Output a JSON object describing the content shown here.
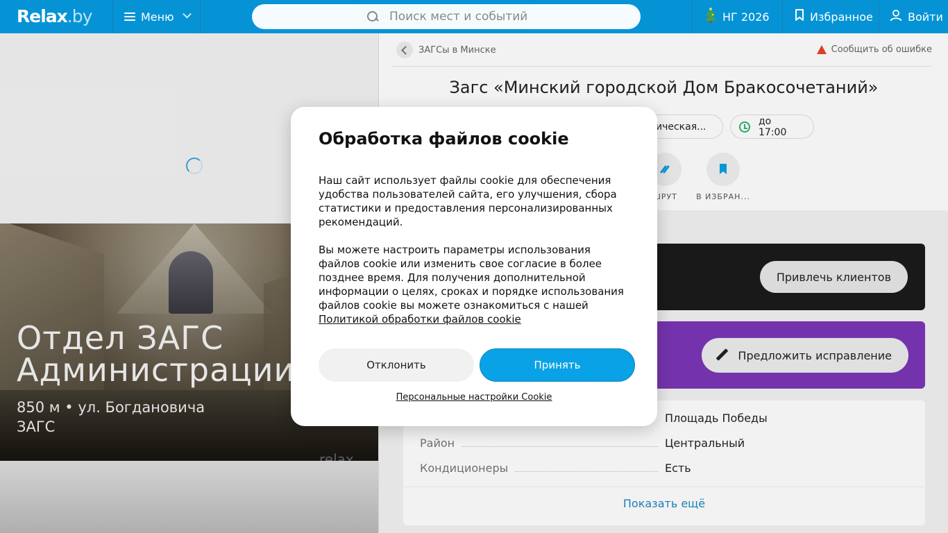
{
  "header": {
    "logo_main": "Relax",
    "logo_tld": ".by",
    "menu_label": "Меню",
    "search_placeholder": "Поиск мест и событий",
    "ny_label": "НГ 2026",
    "favorites_label": "Избранное",
    "login_label": "Войти"
  },
  "hero": {
    "title_line1": "Отдел ЗАГС",
    "title_line2": "Администрации",
    "subtitle_line1": "850 м • ул. Богдановича",
    "subtitle_line2": "ЗАГС",
    "watermark": "relax"
  },
  "place": {
    "breadcrumb": "ЗАГСы в Минске",
    "report_error": "Сообщить об ошибке",
    "title": "Загс «Минский городской Дом Бракосочетаний»",
    "metro_chip": "ическая...",
    "hours_chip": "до 17:00",
    "actions": [
      {
        "label": "ШРУТ"
      },
      {
        "label": "В ИЗБРАН..."
      }
    ],
    "promo_button": "Привлечь клиентов",
    "suggest_button": "Предложить исправление",
    "info": [
      {
        "key": "",
        "value": "Площадь Победы"
      },
      {
        "key": "Район",
        "value": "Центральный"
      },
      {
        "key": "Кондиционеры",
        "value": "Есть"
      }
    ],
    "show_more": "Показать ещё"
  },
  "cookie": {
    "title": "Обработка файлов cookie",
    "para1": "Наш сайт использует файлы cookie для обеспечения удобства пользователей сайта, его улучшения, сбора статистики и предоставления персонализированных рекомендаций.",
    "para2": "Вы можете настроить параметры использования файлов cookie или изменить свое согласие в более позднее время. Для получения дополнительной информации о целях, сроках и порядке использования файлов cookie вы можете ознакомиться с нашей",
    "policy_link": "Политикой обработки файлов cookie",
    "decline": "Отклонить",
    "accept": "Принять",
    "settings_link": "Персональные настройки Cookie"
  },
  "colors": {
    "header_bg": "#0593d6",
    "accept_bg": "#0aa2e6",
    "suggest_bg": "#7b36b6",
    "promo_bg": "#1b1b1b",
    "hours_icon": "#2fb36a",
    "warning_icon": "#e4442a"
  },
  "icons": [
    "burger-icon",
    "chevron-down-icon",
    "search-icon",
    "christmas-tree-icon",
    "bookmark-icon",
    "user-icon",
    "back-arrow-icon",
    "warning-icon",
    "clock-icon",
    "route-icon",
    "pencil-icon",
    "loading-spinner"
  ]
}
